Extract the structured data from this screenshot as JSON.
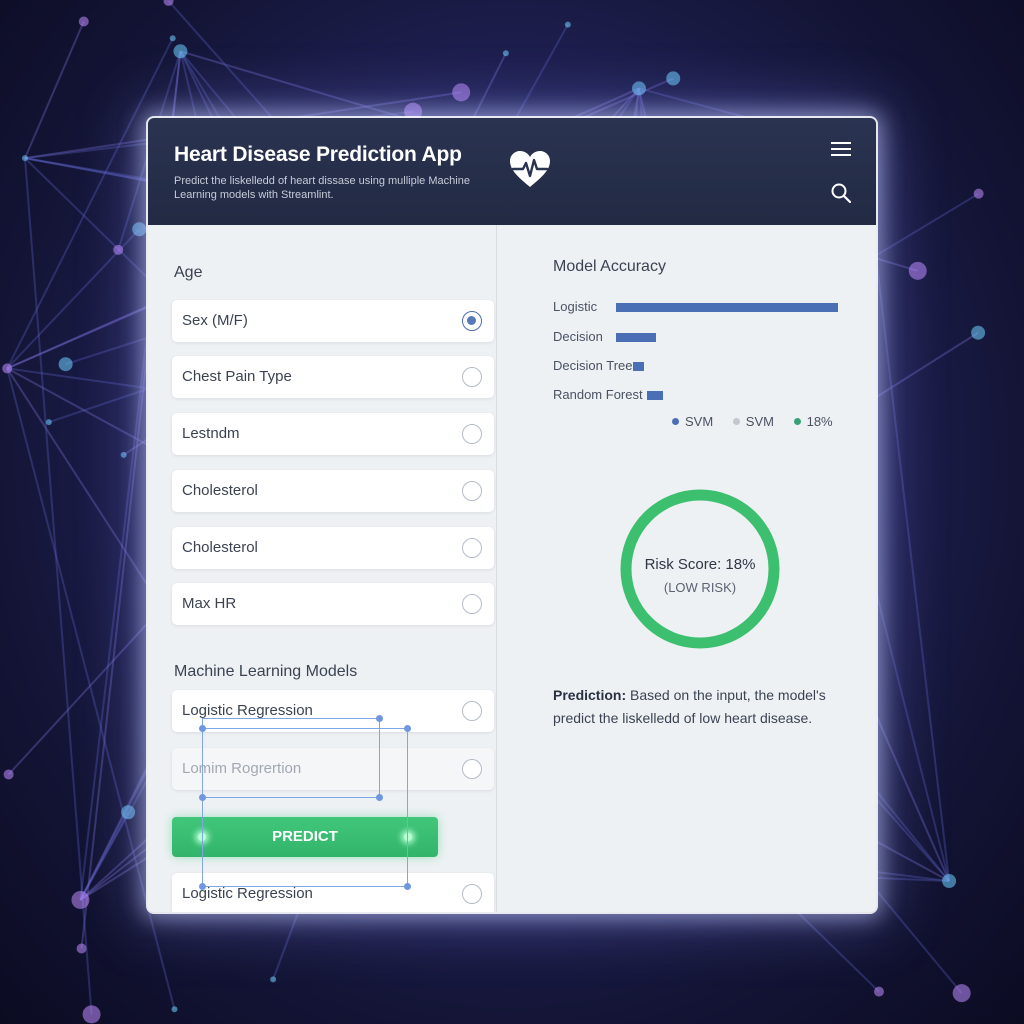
{
  "header": {
    "title": "Heart Disease Prediction App",
    "subtitle": "Predict the liskelledd of heart dissase using mulliple Machine Learning models with Streamlint."
  },
  "inputs": {
    "section_label": "Age",
    "fields": [
      {
        "label": "Sex (M/F)",
        "selected": true
      },
      {
        "label": "Chest Pain Type",
        "selected": false
      },
      {
        "label": "Lestndm",
        "selected": false
      },
      {
        "label": "Cholesterol",
        "selected": false
      },
      {
        "label": "Cholesterol",
        "selected": false
      },
      {
        "label": "Max HR",
        "selected": false
      }
    ]
  },
  "models": {
    "section_label": "Machine Learning Models",
    "items": [
      {
        "label": "Logistic Regression"
      },
      {
        "label": "Lomim Rogrertion"
      },
      {
        "label": "Logistic Regression"
      }
    ],
    "predict_label": "PREDICT"
  },
  "accuracy": {
    "title": "Model Accuracy",
    "rows": [
      {
        "label": "Logistic",
        "fraction": 1.0
      },
      {
        "label": "Decision",
        "fraction": 0.18
      },
      {
        "label": "Decision Tree",
        "fraction": 0.05
      },
      {
        "label": "Random Forest",
        "fraction": 0.07
      }
    ],
    "legend": [
      {
        "label": "SVM",
        "color": "#4a6fb5"
      },
      {
        "label": "SVM",
        "color": "#c3c7cf"
      },
      {
        "label": "18%",
        "color": "#3aa07a"
      }
    ],
    "bar_color": "#4a6fb5"
  },
  "risk": {
    "score_text": "Risk Score: 18%",
    "level_text": "(LOW RISK)",
    "color": "#3cbf6e"
  },
  "prediction": {
    "label": "Prediction:",
    "text": "Based on the input, the model's predict the liskelledd of low heart disease."
  }
}
